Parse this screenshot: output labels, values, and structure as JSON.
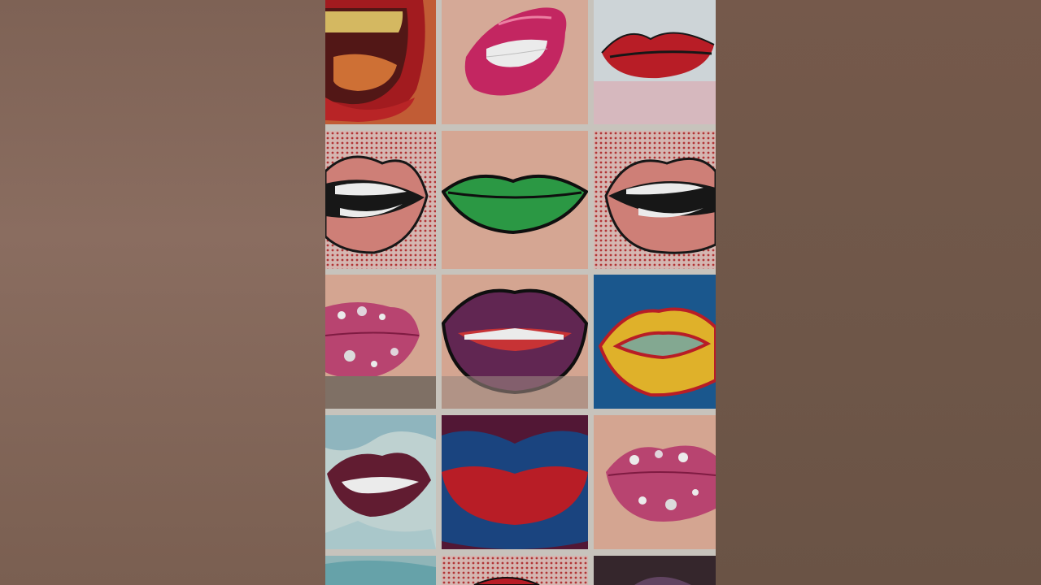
{
  "colors": {
    "background": "#7d6356",
    "grid_gap": "#d8d4cc",
    "lip_red": "#c8202a",
    "lip_pink": "#d42a6a",
    "lip_green": "#2fa54a",
    "lip_purple": "#6a2a5a",
    "lip_yellow": "#f2c12e",
    "pop_blue": "#1d5f9a"
  },
  "tiles": [
    {
      "id": "r1c1",
      "style": "open mouth red pop art"
    },
    {
      "id": "r1c2",
      "style": "glossy pink lips"
    },
    {
      "id": "r1c3",
      "style": "red painted lips sketch"
    },
    {
      "id": "r2c1",
      "style": "halftone red open lips"
    },
    {
      "id": "r2c2",
      "style": "green lips"
    },
    {
      "id": "r2c3",
      "style": "halftone red open lips"
    },
    {
      "id": "r3c1",
      "style": "pink glitter lips"
    },
    {
      "id": "r3c2",
      "style": "purple glitter lips"
    },
    {
      "id": "r3c3",
      "style": "yellow pop lips on blue"
    },
    {
      "id": "r4c1",
      "style": "watercolor dark lips"
    },
    {
      "id": "r4c2",
      "style": "red lips on blue"
    },
    {
      "id": "r4c3",
      "style": "pink glitter lips"
    },
    {
      "id": "r5c1",
      "style": "teal watercolor"
    },
    {
      "id": "r5c2",
      "style": "halftone lips"
    },
    {
      "id": "r5c3",
      "style": "dark lips"
    }
  ]
}
